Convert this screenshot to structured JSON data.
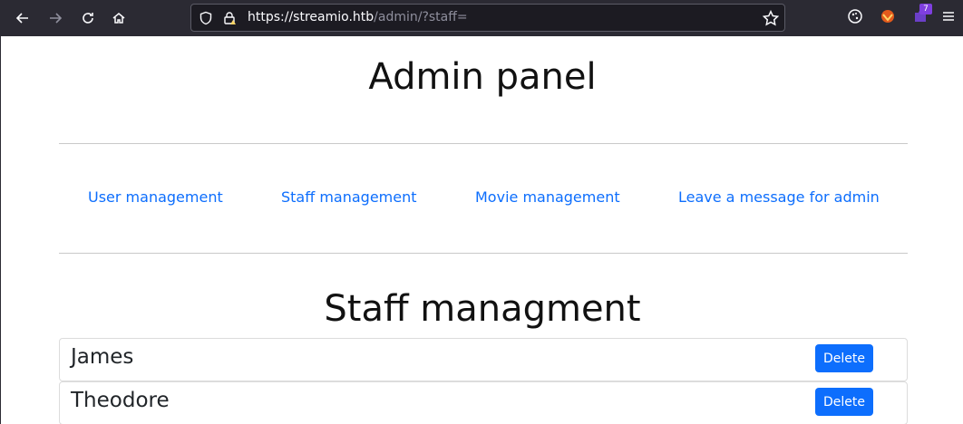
{
  "browser": {
    "url_host": "https://streamio.htb",
    "url_path": "/admin/?staff=",
    "extension_badge": "7"
  },
  "page": {
    "title": "Admin panel",
    "nav": [
      {
        "label": "User management"
      },
      {
        "label": "Staff management"
      },
      {
        "label": "Movie management"
      },
      {
        "label": "Leave a message for admin"
      }
    ],
    "section_title": "Staff managment",
    "staff": [
      {
        "name": "James",
        "action": "Delete"
      },
      {
        "name": "Theodore",
        "action": "Delete"
      }
    ]
  },
  "colors": {
    "link": "#0d6efd",
    "button": "#0d6efd",
    "toolbar": "#2b2a33"
  },
  "icons": [
    "back-icon",
    "forward-icon",
    "reload-icon",
    "home-icon",
    "shield-icon",
    "lock-icon",
    "star-icon",
    "cookie-extension-icon",
    "fox-extension-icon",
    "puzzle-extension-icon",
    "menu-icon"
  ]
}
